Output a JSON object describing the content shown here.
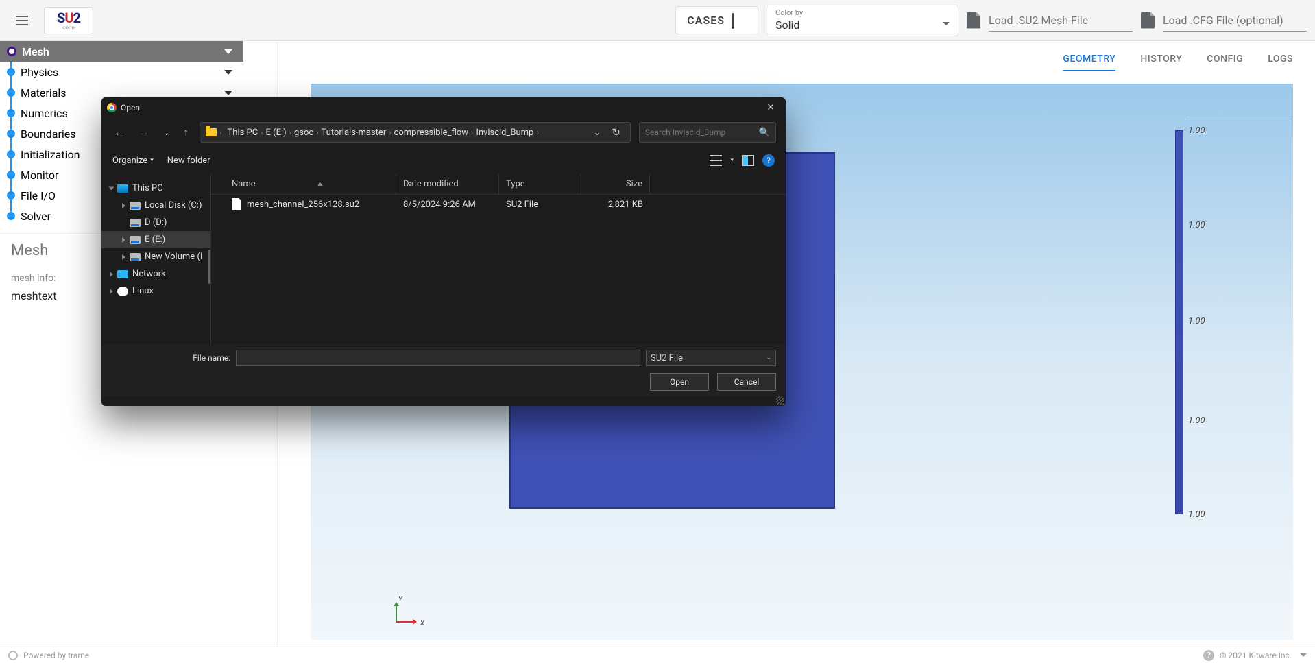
{
  "toolbar": {
    "cases_label": "CASES",
    "colorby_label": "Color by",
    "colorby_value": "Solid",
    "mesh_placeholder": "Load .SU2 Mesh File",
    "cfg_placeholder": "Load .CFG File (optional)"
  },
  "logo": {
    "s": "S",
    "u": "U",
    "two": "2",
    "sub": "code"
  },
  "sidebar": {
    "items": [
      {
        "label": "Mesh",
        "active": true,
        "chev": true
      },
      {
        "label": "Physics",
        "active": false,
        "chev": true
      },
      {
        "label": "Materials",
        "active": false,
        "chev": true
      },
      {
        "label": "Numerics",
        "active": false,
        "chev": false
      },
      {
        "label": "Boundaries",
        "active": false,
        "chev": false
      },
      {
        "label": "Initialization",
        "active": false,
        "chev": false
      },
      {
        "label": "Monitor",
        "active": false,
        "chev": false
      },
      {
        "label": "File I/O",
        "active": false,
        "chev": false
      },
      {
        "label": "Solver",
        "active": false,
        "chev": false
      }
    ],
    "section_title": "Mesh",
    "mesh_info_label": "mesh info:",
    "mesh_text": "meshtext"
  },
  "tabs": [
    {
      "label": "GEOMETRY",
      "active": true
    },
    {
      "label": "HISTORY",
      "active": false
    },
    {
      "label": "CONFIG",
      "active": false
    },
    {
      "label": "LOGS",
      "active": false
    }
  ],
  "axis": {
    "x": "X",
    "y": "Y"
  },
  "colorbar": {
    "ticks": [
      "1.00",
      "1.00",
      "1.00",
      "1.00",
      "1.00"
    ]
  },
  "status": {
    "powered": "Powered by trame",
    "copyright": "© 2021 Kitware Inc."
  },
  "dialog": {
    "title": "Open",
    "crumbs": [
      "This PC",
      "E (E:)",
      "gsoc",
      "Tutorials-master",
      "compressible_flow",
      "Inviscid_Bump"
    ],
    "search_placeholder": "Search Inviscid_Bump",
    "organize": "Organize",
    "newfolder": "New folder",
    "columns": {
      "name": "Name",
      "date": "Date modified",
      "type": "Type",
      "size": "Size"
    },
    "tree": [
      {
        "label": "This PC",
        "icon": "pc",
        "indent": 0,
        "chev": "open"
      },
      {
        "label": "Local Disk (C:)",
        "icon": "disk",
        "indent": 1,
        "chev": "closed"
      },
      {
        "label": "D (D:)",
        "icon": "disk",
        "indent": 1,
        "chev": "none"
      },
      {
        "label": "E (E:)",
        "icon": "disk",
        "indent": 1,
        "chev": "closed",
        "sel": true
      },
      {
        "label": "New Volume (I",
        "icon": "disk",
        "indent": 1,
        "chev": "closed"
      },
      {
        "label": "Network",
        "icon": "net",
        "indent": 0,
        "chev": "closed"
      },
      {
        "label": "Linux",
        "icon": "linux",
        "indent": 0,
        "chev": "closed"
      }
    ],
    "files": [
      {
        "name": "mesh_channel_256x128.su2",
        "date": "8/5/2024 9:26 AM",
        "type": "SU2 File",
        "size": "2,821 KB"
      }
    ],
    "filename_label": "File name:",
    "filename_value": "",
    "filetype": "SU2 File",
    "open_btn": "Open",
    "cancel_btn": "Cancel"
  }
}
